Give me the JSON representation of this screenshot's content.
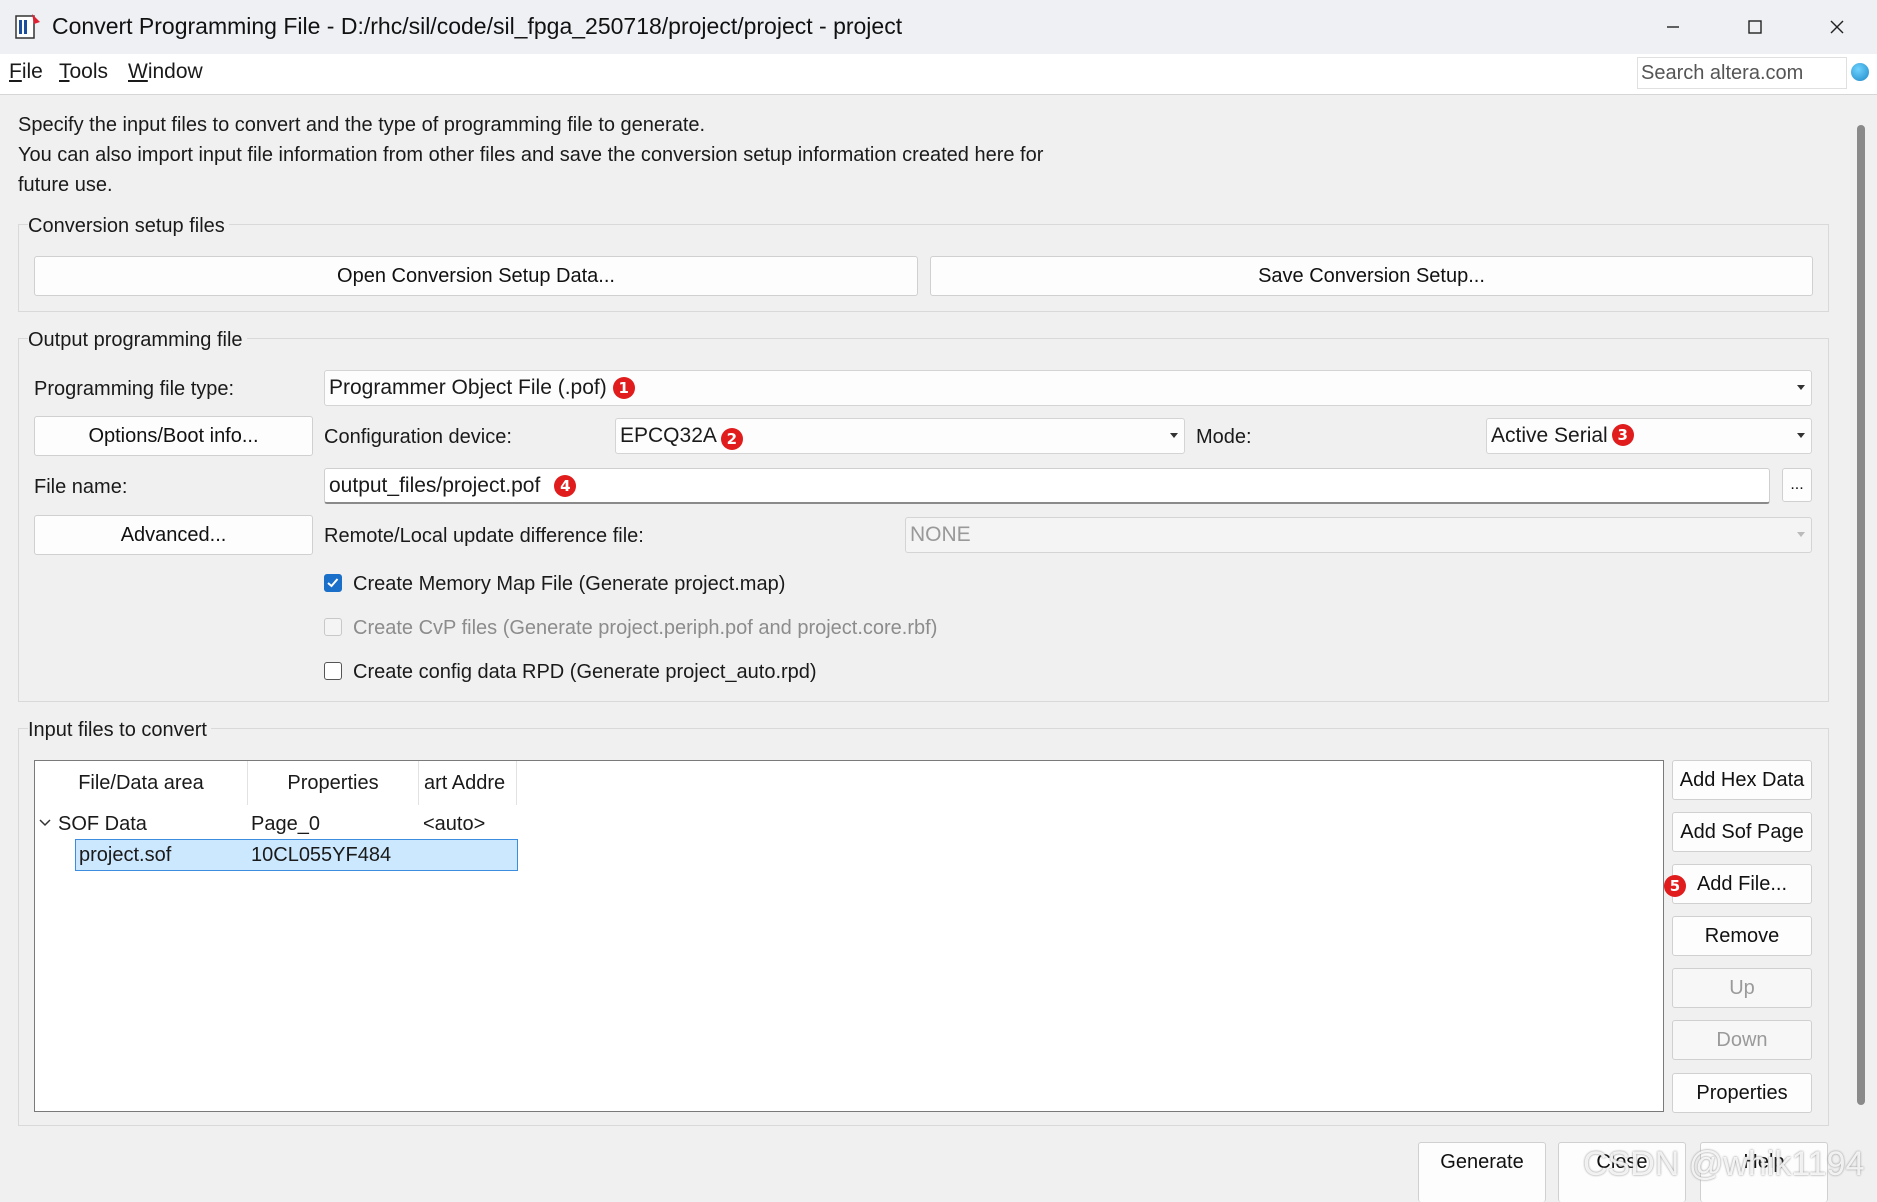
{
  "window": {
    "title": "Convert Programming File - D:/rhc/sil/code/sil_fpga_250718/project/project - project"
  },
  "menubar": {
    "items": [
      {
        "mnemonic": "F",
        "rest": "ile"
      },
      {
        "mnemonic": "T",
        "rest": "ools"
      },
      {
        "mnemonic": "W",
        "rest": "indow"
      }
    ],
    "search_placeholder": "Search altera.com"
  },
  "intro": {
    "line1": "Specify the input files to convert and the type of programming file to generate.",
    "line2": "You can also import input file information from other files and save the conversion setup information created here for",
    "line3": "future use."
  },
  "setup_group": {
    "label": "Conversion setup files",
    "open_button": "Open Conversion Setup Data...",
    "save_button": "Save Conversion Setup..."
  },
  "output_group": {
    "label": "Output programming file",
    "file_type_label": "Programming file type:",
    "file_type_value": "Programmer Object File (.pof)",
    "options_button": "Options/Boot info...",
    "config_device_label": "Configuration device:",
    "config_device_value": "EPCQ32A",
    "mode_label": "Mode:",
    "mode_value": "Active Serial",
    "file_name_label": "File name:",
    "file_name_value": "output_files/project.pof",
    "browse_button": "...",
    "advanced_button": "Advanced...",
    "remote_local_label": "Remote/Local update difference file:",
    "remote_local_value": "NONE",
    "checkboxes": [
      {
        "label": "Create Memory Map File (Generate project.map)",
        "checked": true,
        "enabled": true
      },
      {
        "label": "Create CvP files (Generate project.periph.pof and project.core.rbf)",
        "checked": false,
        "enabled": false
      },
      {
        "label": "Create config data RPD (Generate project_auto.rpd)",
        "checked": false,
        "enabled": true
      }
    ]
  },
  "annotations": [
    "1",
    "2",
    "3",
    "4",
    "5"
  ],
  "input_group": {
    "label": "Input files to convert",
    "columns": [
      "File/Data area",
      "Properties",
      "art Addre"
    ],
    "rows": [
      {
        "file": "SOF Data",
        "properties": "Page_0",
        "start": "<auto>",
        "expanded": true
      },
      {
        "file": "project.sof",
        "properties": "10CL055YF484",
        "start": "",
        "selected": true
      }
    ],
    "buttons": {
      "add_hex": "Add Hex Data",
      "add_sof": "Add Sof Page",
      "add_file": "Add File...",
      "remove": "Remove",
      "up": "Up",
      "down": "Down",
      "properties": "Properties"
    }
  },
  "footer_buttons": {
    "generate": "Generate",
    "close": "Close",
    "help": "Help"
  },
  "watermark": "CSDN @whik1194"
}
